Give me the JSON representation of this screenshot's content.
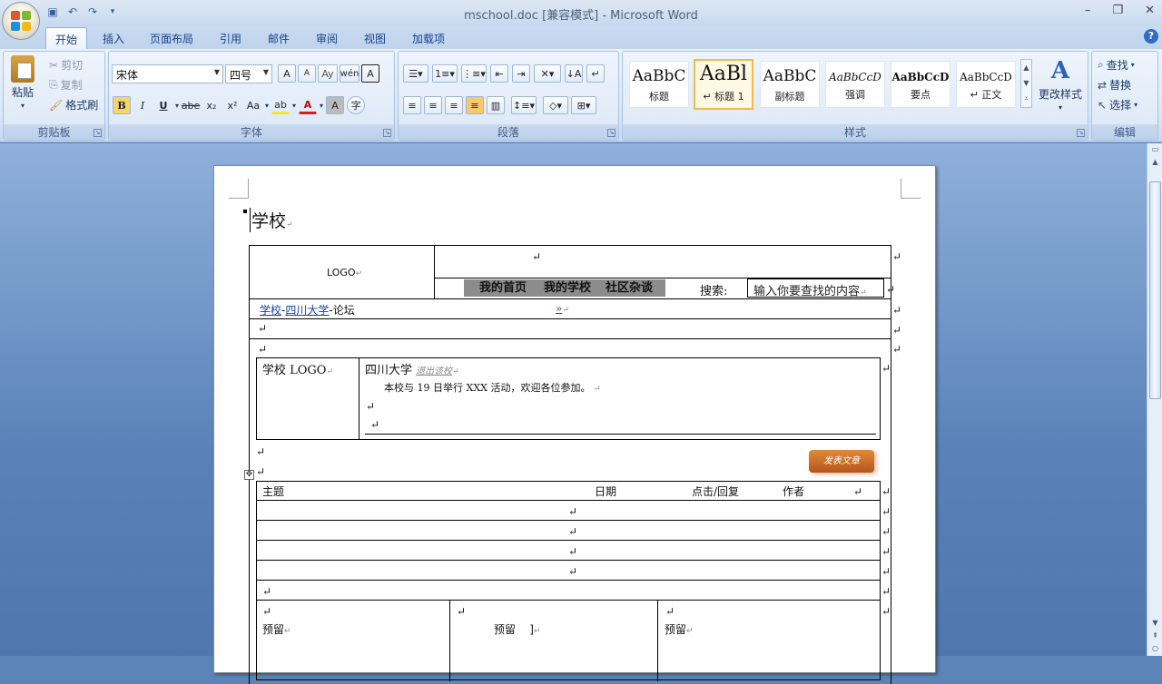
{
  "window": {
    "title": "mschool.doc [兼容模式] - Microsoft Word",
    "controls": [
      "–",
      "❐",
      "✕"
    ]
  },
  "tabs": [
    "开始",
    "插入",
    "页面布局",
    "引用",
    "邮件",
    "审阅",
    "视图",
    "加载项"
  ],
  "ribbon": {
    "clipboard": {
      "paste": "粘贴",
      "cut": "剪切",
      "copy": "复制",
      "format_painter": "格式刷",
      "label": "剪贴板"
    },
    "font": {
      "name": "宋体",
      "size": "四号",
      "label": "字体",
      "case": "Aa",
      "bold": "B",
      "italic": "I",
      "underline": "U",
      "strike": "abe",
      "sub": "x₂",
      "sup": "x²",
      "grow": "A",
      "shrink": "A",
      "phonetic": "wén",
      "border_char": "A",
      "shade_char": "A",
      "enclose": "字"
    },
    "paragraph": {
      "label": "段落"
    },
    "styles": {
      "label": "样式",
      "items": [
        {
          "sample": "AaBbC",
          "name": "标题"
        },
        {
          "sample": "AaBl",
          "name": "↵ 标题 1"
        },
        {
          "sample": "AaBbC",
          "name": "副标题"
        },
        {
          "sample": "AaBbCcD",
          "name": "强调"
        },
        {
          "sample": "AaBbCcD",
          "name": "要点"
        },
        {
          "sample": "AaBbCcD",
          "name": "↵ 正文"
        }
      ],
      "change": "更改样式"
    },
    "editing": {
      "find": "查找",
      "replace": "替换",
      "select": "选择",
      "label": "编辑"
    }
  },
  "document": {
    "heading": "学校",
    "logo": "LOGO",
    "nav": [
      "我的首页",
      "我的学校",
      "社区杂谈"
    ],
    "search_label": "搜索:",
    "search_placeholder": "输入你要查找的内容",
    "breadcrumb": {
      "school": "学校",
      "sep1": "-",
      "univ": "四川大学",
      "sep2": "-",
      "forum": "论坛",
      "more": "»"
    },
    "school_logo": "学校 LOGO",
    "school_name": "四川大学",
    "quit_link": "退出该校",
    "notice": "本校与 19 日举行 XXX 活动，欢迎各位参加。",
    "post_button": "发表文章",
    "table_headers": [
      "主题",
      "日期",
      "点击/回复",
      "作者"
    ],
    "reserved": [
      "预留",
      "预留",
      "预留"
    ],
    "para_mark": "↵"
  }
}
